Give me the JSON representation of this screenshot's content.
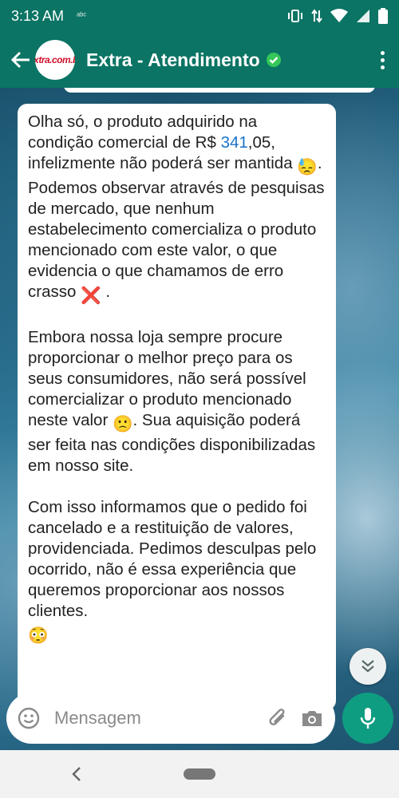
{
  "status_bar": {
    "time": "3:13 AM",
    "badge": "ᵃᵇᶜ"
  },
  "header": {
    "avatar_text": "extra.com.br",
    "title": "Extra - Atendimento",
    "verified_icon": "verified-icon",
    "menu_icon": "more-vert-icon"
  },
  "message": {
    "p1_before_price": "Olha só, o produto adquirido na condição comercial de R$ ",
    "p1_price_link": "341",
    "p1_after_price": ",05, infelizmente não poderá ser mantida",
    "p1_emoji_1": "😓",
    "p1_after_emoji": ". Podemos observar através de pesquisas de mercado, que nenhum estabelecimento comercializa o produto mencionado com este valor, o que evidencia o que chamamos de erro crasso",
    "p1_emoji_2": "❌",
    "p1_end": " .",
    "p2_before_emoji": "Embora nossa loja sempre procure proporcionar o melhor preço para os seus consumidores, não será possível comercializar o produto mencionado neste valor",
    "p2_emoji": "🙁",
    "p2_after_emoji": ". Sua aquisição poderá ser feita nas condições disponibilizadas em nosso site.",
    "p3": "Com isso informamos que o pedido foi cancelado e a restituição de valores, providenciada. Pedimos desculpas pelo ocorrido, não é essa experiência que queremos proporcionar aos nossos clientes.",
    "p3_emoji": "😳"
  },
  "input": {
    "placeholder": "Mensagem",
    "emoji_icon": "emoji-icon",
    "attach_icon": "paperclip-icon",
    "camera_icon": "camera-icon",
    "mic_icon": "mic-icon"
  },
  "colors": {
    "header_bg": "#0b7464",
    "mic_bg": "#0f9d82",
    "link": "#1a73c9"
  }
}
